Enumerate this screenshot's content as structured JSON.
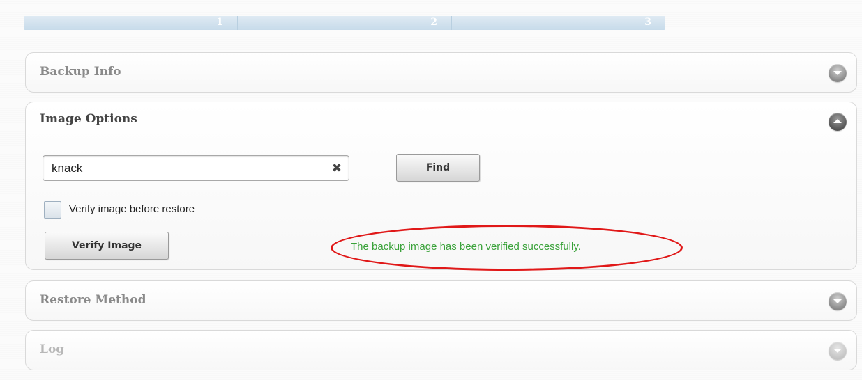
{
  "progress": {
    "steps": [
      "1",
      "2",
      "3"
    ]
  },
  "panels": {
    "backup_info": {
      "title": "Backup Info",
      "state": "collapsed"
    },
    "image_options": {
      "title": "Image Options",
      "state": "expanded",
      "search_value": "knack",
      "clear_symbol": "✖",
      "find_label": "Find",
      "verify_checkbox_label": "Verify image before restore",
      "verify_checkbox_checked": false,
      "verify_button_label": "Verify Image",
      "status_message": "The backup image has been verified successfully.",
      "status_color": "#3aa23a",
      "highlight_color": "#e01818"
    },
    "restore_method": {
      "title": "Restore Method",
      "state": "collapsed"
    },
    "log": {
      "title": "Log",
      "state": "collapsed"
    }
  },
  "icons": {
    "collapsed": "chevron-down-icon",
    "expanded": "chevron-up-icon"
  }
}
